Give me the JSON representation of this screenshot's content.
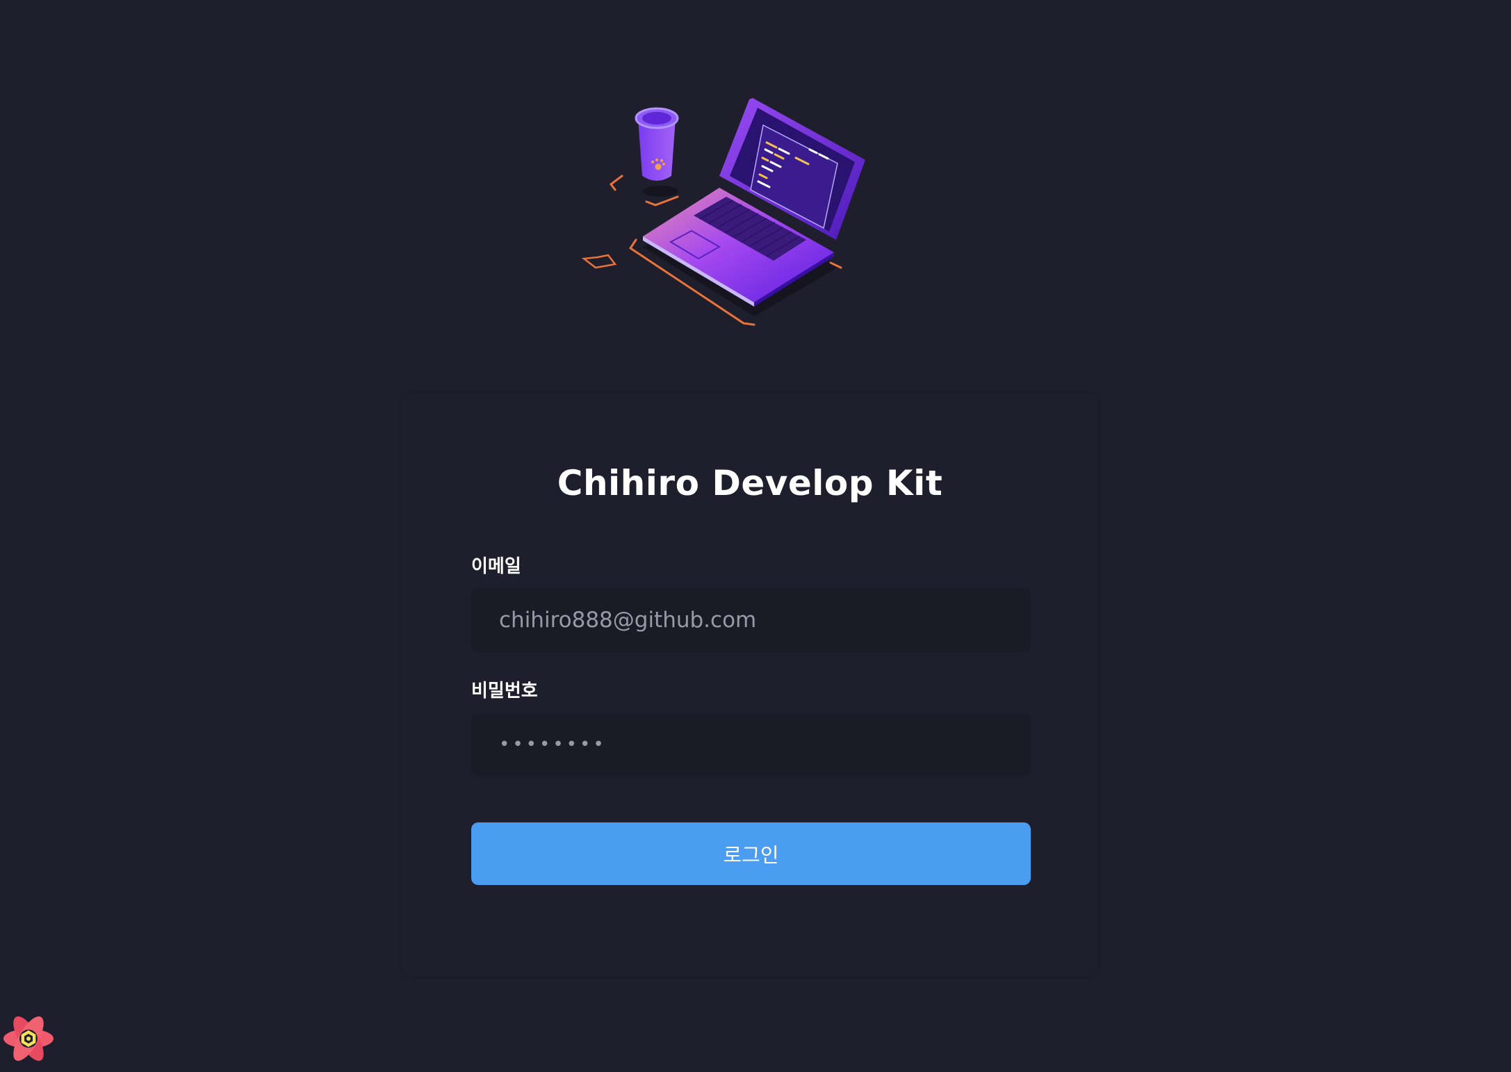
{
  "login": {
    "title": "Chihiro Develop Kit",
    "email_label": "이메일",
    "email_value": "chihiro888@github.com",
    "password_label": "비밀번호",
    "password_value": "••••••••",
    "login_button": "로그인"
  },
  "colors": {
    "background": "#1f1e2c",
    "input_background": "#1b1b26",
    "primary_button": "#4a9df0",
    "laptop_purple": "#7b2ff7",
    "accent_orange": "#e8743b"
  },
  "icons": {
    "hero": "laptop-coffee-illustration",
    "devtools": "react-query-devtools-icon"
  }
}
